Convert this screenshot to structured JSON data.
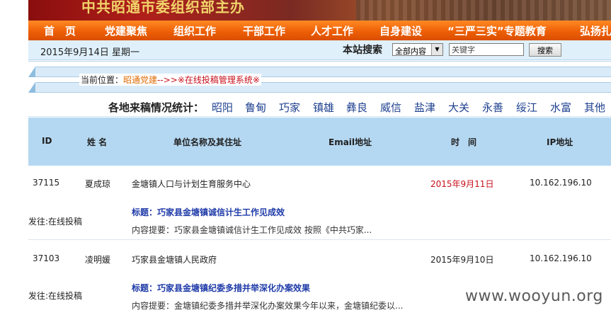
{
  "banner": {
    "title": "中共昭通市委组织部主办"
  },
  "nav": {
    "items": [
      "首　页",
      "党建聚焦",
      "组织工作",
      "干部工作",
      "人才工作",
      "自身建设",
      "“三严三实”专题教育",
      "弘扬扎"
    ]
  },
  "topbar": {
    "date": "2015年9月14日  星期一",
    "search_label": "本站搜索",
    "scope_selected": "全部内容",
    "keyword_placeholder": "关键字",
    "search_button": "搜索"
  },
  "breadcrumb": {
    "prefix": "当前位置：",
    "home": "昭通党建",
    "separator": "-->>",
    "system": "※在线投稿管理系统※"
  },
  "stats": {
    "label": "各地来稿情况统计：",
    "regions": [
      "昭阳",
      "鲁甸",
      "巧家",
      "镇雄",
      "彝良",
      "威信",
      "盐津",
      "大关",
      "永善",
      "绥江",
      "水富",
      "其他"
    ]
  },
  "table": {
    "headers": {
      "id": "ID",
      "name": "姓 名",
      "unit": "单位名称及其住址",
      "email": "Email地址",
      "time": "时　间",
      "ip": "IP地址"
    },
    "rows": [
      {
        "id": "37115",
        "name": "夏成琼",
        "unit": "金塘镇人口与计划生育服务中心",
        "time": "2015年9月11日",
        "ip": "10.162.196.10",
        "sent_to": "发往:在线投稿",
        "title": "标题：巧家县金塘镇诚信计生工作见成效",
        "summary": "内容提要：巧家县金塘镇诚信计生工作见成效 按照《中共巧家..."
      },
      {
        "id": "37103",
        "name": "凌明媛",
        "unit": "巧家县金塘镇人民政府",
        "time": "2015年9月10日",
        "ip": "10.162.196.10",
        "sent_to": "发往:在线投稿",
        "title": "标题：巧家县金塘镇纪委多措并举深化办案效果",
        "summary": "内容提要：金塘镇纪委多措并举深化办案效果今年以来，金塘镇纪委以..."
      }
    ]
  },
  "watermark": "www.wooyun.org",
  "colors": {
    "nav": "#ee5f06",
    "header": "#b5d8f2",
    "link": "#1e3aa8",
    "red": "#c8101c"
  }
}
